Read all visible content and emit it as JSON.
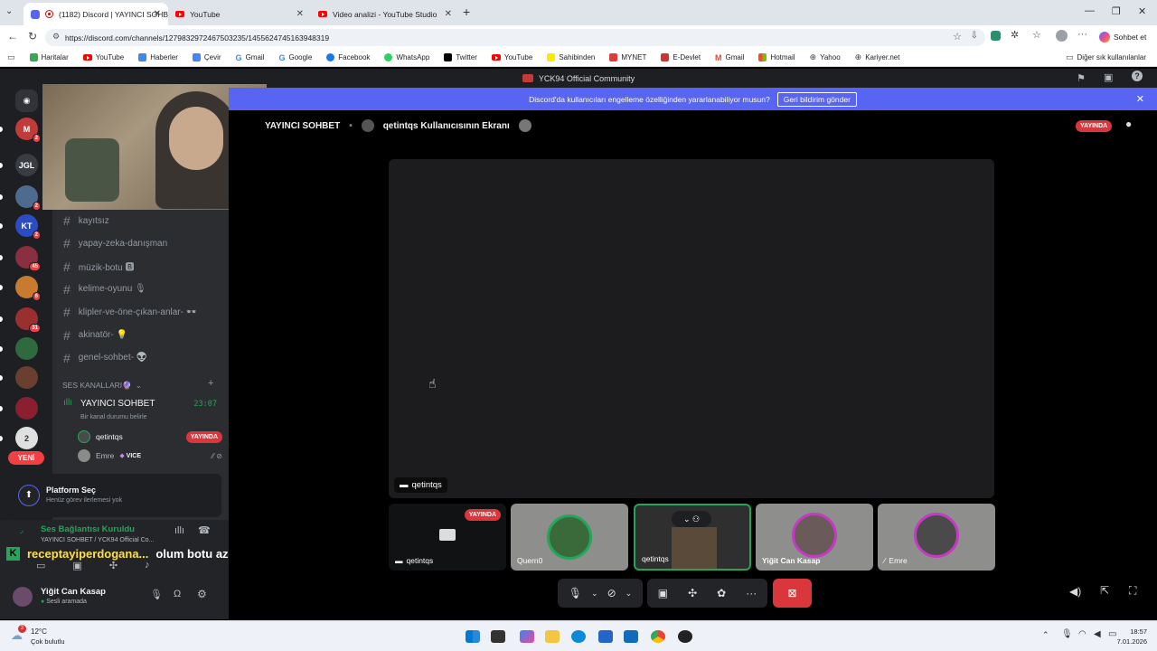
{
  "browser": {
    "tabs": [
      {
        "title": "(1182) Discord | YAYINCI SOHB",
        "close": "✕"
      },
      {
        "title": "YouTube",
        "close": "✕"
      },
      {
        "title": "Video analizi - YouTube Studio",
        "close": "✕"
      }
    ],
    "new_tab": "+",
    "url": "https://discord.com/channels/1279832972467503235/1455624745163948319",
    "chat_button": "Sohbet et",
    "bookmarks": [
      "Haritalar",
      "YouTube",
      "Haberler",
      "Çevir",
      "Gmail",
      "Google",
      "Facebook",
      "WhatsApp",
      "Twitter",
      "YouTube",
      "Sahibinden",
      "MYNET",
      "E-Devlet",
      "Gmail",
      "Hotmail",
      "Yahoo",
      "Kariyer.net"
    ],
    "other_bookmarks": "Diğer sık kullanılanlar"
  },
  "discord": {
    "window_title": "YCK94 Official Community",
    "banner_text": "Discord'da kullanıcıları engelleme özelliğinden yararlanabiliyor musun?",
    "banner_button": "Geri bildirim gönder",
    "guilds": [
      {
        "label": "M",
        "badge": "2",
        "color": "#c23b3b"
      },
      {
        "label": "JGL",
        "badge": "",
        "color": "#3a3c43"
      },
      {
        "label": "",
        "badge": "2",
        "color": "#4d6a8f"
      },
      {
        "label": "KT",
        "badge": "2",
        "color": "#2b4cc4"
      },
      {
        "label": "",
        "badge": "45",
        "color": "#8a2f3f"
      },
      {
        "label": "",
        "badge": "6",
        "color": "#c87a2f"
      },
      {
        "label": "",
        "badge": "31",
        "color": "#9a2f2f"
      },
      {
        "label": "",
        "badge": "",
        "color": "#2f6a3f"
      },
      {
        "label": "",
        "badge": "",
        "color": "#6a3f2f"
      },
      {
        "label": "",
        "badge": "",
        "color": "#8a1f2f"
      },
      {
        "label": "2",
        "badge": "",
        "color": "#e0e0e0"
      }
    ],
    "new_label": "YENİ",
    "text_channels": [
      "kayıtsız",
      "yapay-zeka-danışman",
      "müzik-botu 🅱",
      "kelime-oyunu 🎙",
      "klipler-ve-öne-çıkan-anlar- 👓",
      "akinatör- 💡",
      "genel-sohbet- 👽"
    ],
    "voice_category": "SES KANALLARI🔮",
    "voice_channel": {
      "name": "YAYINCI SOHBET",
      "time": "23:07",
      "status": "Bir kanal durumu belirle"
    },
    "voice_members": [
      {
        "name": "qetintqs",
        "tag": "YAYINDA"
      },
      {
        "name": "Emre",
        "tag": "VICE"
      }
    ],
    "platform": {
      "title": "Platform Seç",
      "subtitle": "Henüz görev ilerlemesi yok"
    },
    "connection": {
      "title": "Ses Bağlantısı Kuruldu",
      "subtitle": "YAYINCI SOHBET / YCK94 Official Co..."
    },
    "overlay_text": {
      "name": "receptayiperdogana...",
      "message": "olum botu az bas lan"
    },
    "user": {
      "name": "Yiğit Can Kasap",
      "status": "Sesli aramada"
    },
    "stage": {
      "header_channel": "YAYINCI SOHBET",
      "header_screen": "qetintqs Kullanıcısının Ekranı",
      "live": "YAYINDA",
      "screen_label": "qetintqs",
      "tiles": [
        {
          "name": "qetintqs",
          "live": "YAYINDA"
        },
        {
          "name": "Quern0"
        },
        {
          "name": "qetintqs"
        },
        {
          "name": "Yiğit Can Kasap"
        },
        {
          "name": "Emre"
        }
      ]
    }
  },
  "taskbar": {
    "weather_temp": "12°C",
    "weather_desc": "Çok bulutlu",
    "time": "18:57",
    "date": "7.01.2026"
  }
}
